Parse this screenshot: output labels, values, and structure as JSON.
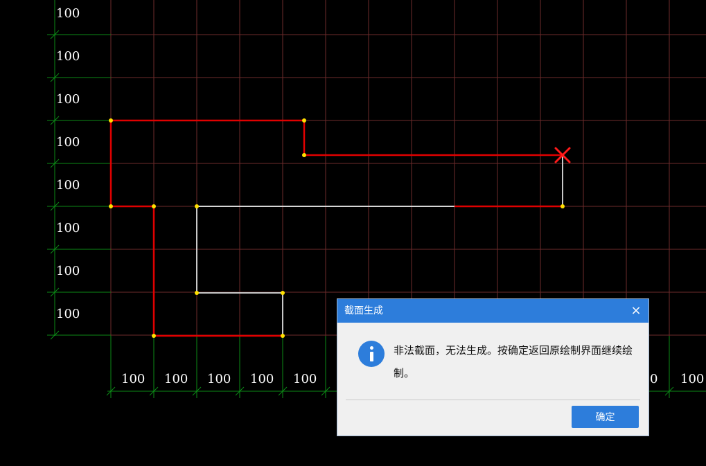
{
  "grid": {
    "left_labels": [
      "100",
      "100",
      "100",
      "100",
      "100",
      "100",
      "100",
      "100"
    ],
    "bottom_labels": [
      "100",
      "100",
      "100",
      "100",
      "100",
      "0",
      "100"
    ],
    "colors": {
      "major_grid": "#7a2f2f",
      "dimension_lines": "#0c8a16",
      "section_outline": "#e00000",
      "inner_outline": "#c8c8c8",
      "vertex": "#ffe000",
      "error_marker": "#ff1a1a"
    }
  },
  "dialog": {
    "title": "截面生成",
    "close_label": "×",
    "icon": "info-icon",
    "message": "非法截面，无法生成。按确定返回原绘制界面继续绘制。",
    "ok_label": "确定"
  }
}
